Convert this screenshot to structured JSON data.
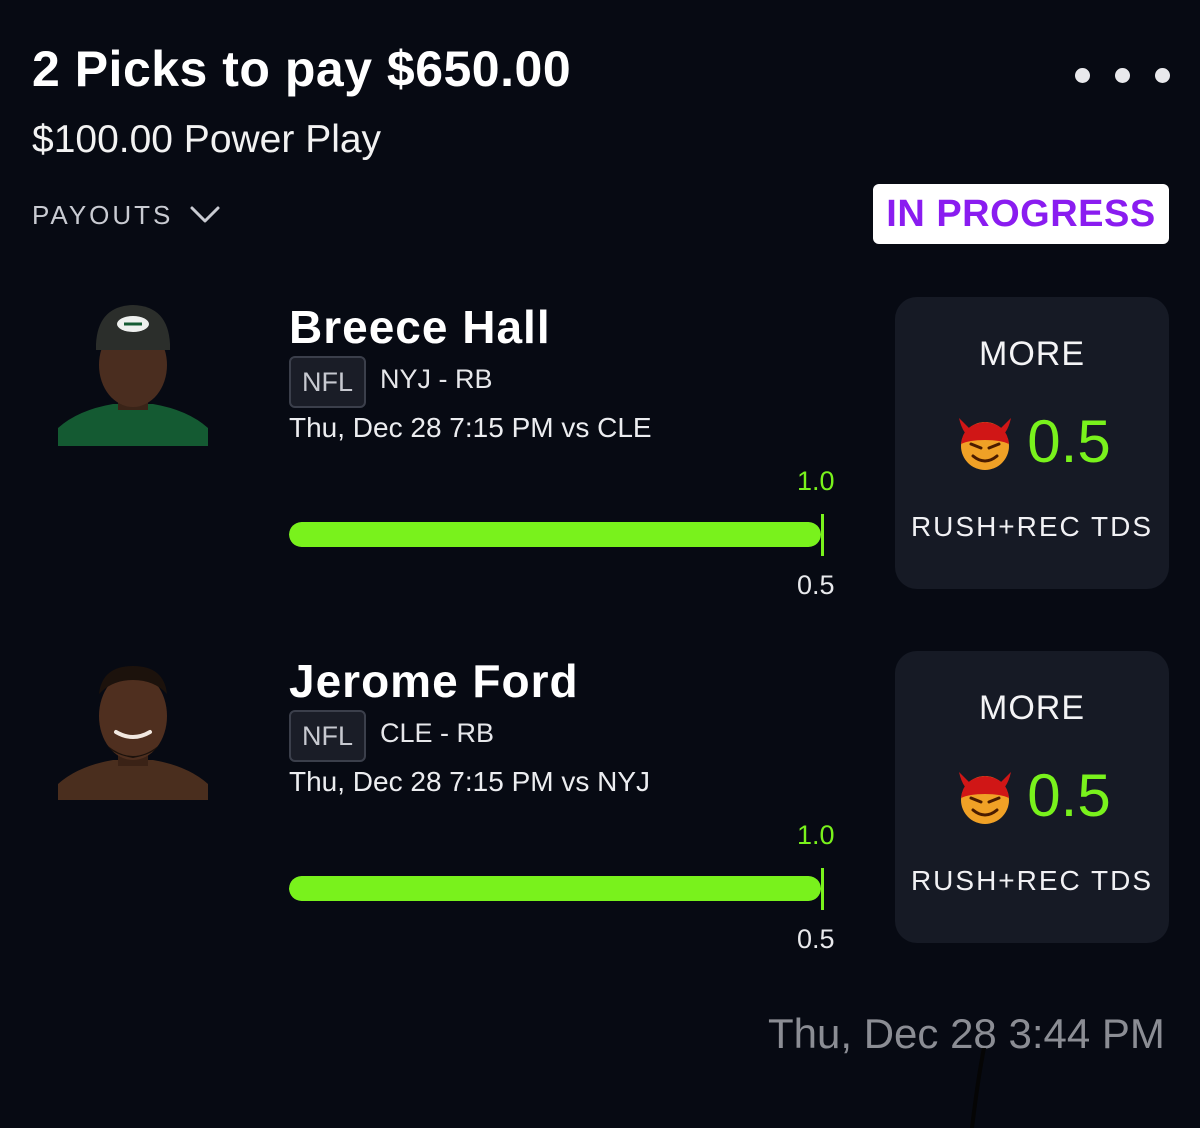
{
  "header": {
    "title": "2 Picks to pay $650.00",
    "subtitle": "$100.00 Power Play",
    "payouts_label": "PAYOUTS",
    "status": "IN PROGRESS"
  },
  "colors": {
    "background": "#070a13",
    "accent_green": "#79f21c",
    "status_purple": "#8a1cf0",
    "card_bg": "#161a25"
  },
  "picks": [
    {
      "player": "Breece Hall",
      "league": "NFL",
      "team_pos": "NYJ - RB",
      "game_time": "Thu, Dec 28 7:15 PM  vs CLE",
      "actual": "1.0",
      "line_label": "0.5",
      "progress_fraction": 1.0,
      "direction": "MORE",
      "line": "0.5",
      "stat": "RUSH+REC TDS",
      "jersey_color": "#145a32",
      "icon": "demon-icon"
    },
    {
      "player": "Jerome Ford",
      "league": "NFL",
      "team_pos": "CLE - RB",
      "game_time": "Thu, Dec 28 7:15 PM  vs NYJ",
      "actual": "1.0",
      "line_label": "0.5",
      "progress_fraction": 1.0,
      "direction": "MORE",
      "line": "0.5",
      "stat": "RUSH+REC TDS",
      "jersey_color": "#4a2e1e",
      "icon": "demon-icon"
    }
  ],
  "footer": {
    "timestamp": "Thu, Dec 28 3:44 PM"
  }
}
